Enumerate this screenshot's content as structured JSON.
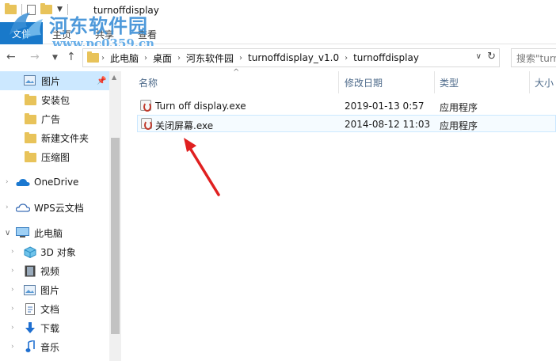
{
  "window": {
    "title": "turnoffdisplay"
  },
  "ribbon": {
    "file_tab": "文件",
    "tabs": [
      "主页",
      "共享",
      "查看"
    ]
  },
  "watermark": {
    "name": "河东软件园",
    "url": "www.pc0359.cn"
  },
  "address": {
    "crumbs": [
      "此电脑",
      "桌面",
      "河东软件园",
      "turnoffdisplay_v1.0",
      "turnoffdisplay"
    ]
  },
  "search": {
    "placeholder": "搜索\"turnoffdisplay\""
  },
  "sidebar": {
    "items": [
      {
        "label": "图片",
        "icon": "pictures-icon",
        "pinned": true,
        "selected": true
      },
      {
        "label": "安装包",
        "icon": "folder-icon"
      },
      {
        "label": "广告",
        "icon": "folder-icon"
      },
      {
        "label": "新建文件夹",
        "icon": "folder-icon"
      },
      {
        "label": "压缩图",
        "icon": "folder-icon"
      },
      {
        "label": "OneDrive",
        "icon": "onedrive-icon"
      },
      {
        "label": "WPS云文档",
        "icon": "cloud-icon"
      },
      {
        "label": "此电脑",
        "icon": "computer-icon"
      },
      {
        "label": "3D 对象",
        "icon": "3d-objects-icon"
      },
      {
        "label": "视频",
        "icon": "videos-icon"
      },
      {
        "label": "图片",
        "icon": "pictures-icon"
      },
      {
        "label": "文档",
        "icon": "documents-icon"
      },
      {
        "label": "下载",
        "icon": "downloads-icon"
      },
      {
        "label": "音乐",
        "icon": "music-icon"
      }
    ]
  },
  "columns": {
    "name": "名称",
    "modified": "修改日期",
    "type": "类型",
    "size": "大小"
  },
  "files": [
    {
      "name": "Turn off display.exe",
      "modified": "2019-01-13 0:57",
      "type": "应用程序"
    },
    {
      "name": "关闭屏幕.exe",
      "modified": "2014-08-12 11:03",
      "type": "应用程序"
    }
  ],
  "colors": {
    "accent": "#1979ca",
    "selection": "#cce8ff",
    "arrow": "#e02020"
  }
}
